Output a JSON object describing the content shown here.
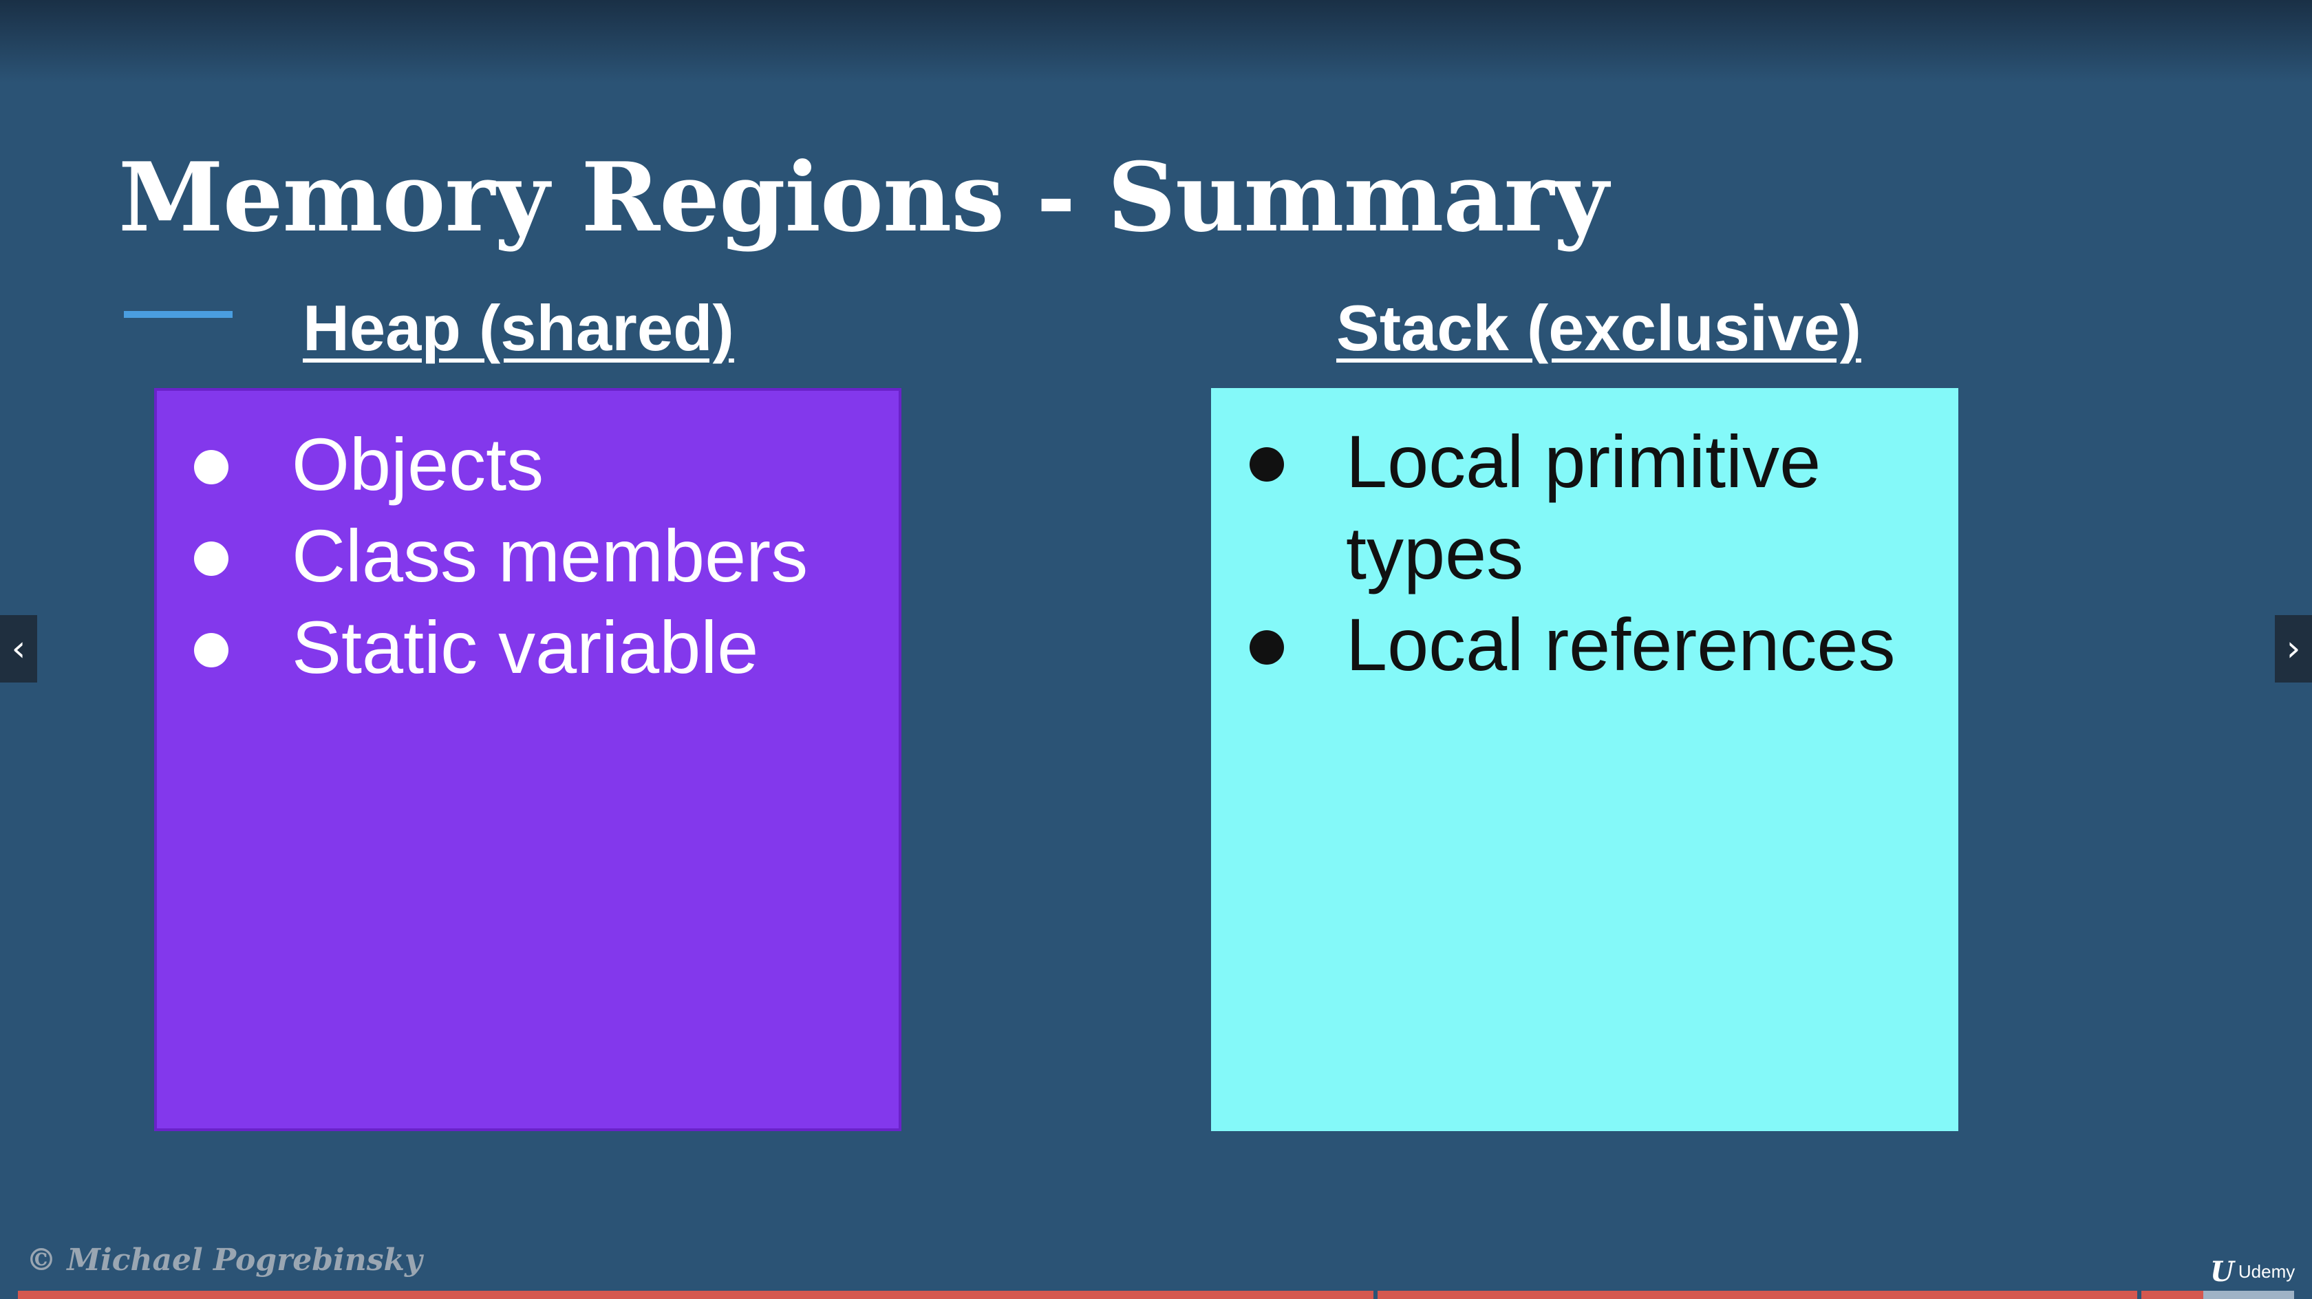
{
  "slide": {
    "title": "Memory Regions - Summary",
    "heap": {
      "heading": "Heap (shared)",
      "items": [
        "Objects",
        "Class members",
        "Static variable"
      ]
    },
    "stack": {
      "heading": "Stack (exclusive)",
      "items": [
        {
          "line1": "Local primitive",
          "line2": "types"
        },
        {
          "line1": "Local references",
          "line2": ""
        }
      ]
    },
    "copyright": "© Michael Pogrebinsky"
  },
  "player": {
    "prev_icon": "‹",
    "next_icon": "›",
    "brand_mark": "U",
    "brand_name": "Udemy",
    "progress": 0.96,
    "buffered": 1.0
  },
  "colors": {
    "background": "#2b5375",
    "heap_box": "#8338ec",
    "stack_box": "#84f9f9",
    "progress": "#d5584f",
    "accent": "#4a9ee0"
  }
}
